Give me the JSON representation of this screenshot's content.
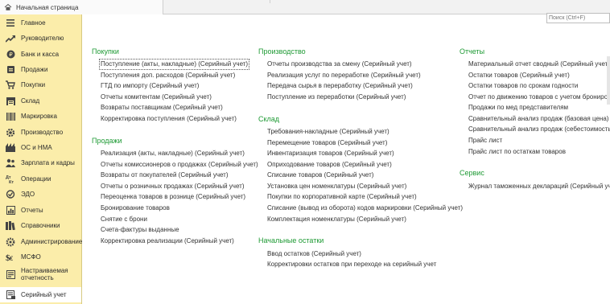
{
  "tabbar": {
    "home_label": "Начальная страница"
  },
  "search": {
    "placeholder": "Поиск (Ctrl+F)"
  },
  "sidebar": {
    "items": [
      {
        "label": "Главное",
        "icon": "menu-icon"
      },
      {
        "label": "Руководителю",
        "icon": "trend-icon"
      },
      {
        "label": "Банк и касса",
        "icon": "coin-icon"
      },
      {
        "label": "Продажи",
        "icon": "cart-icon"
      },
      {
        "label": "Покупки",
        "icon": "basket-icon"
      },
      {
        "label": "Склад",
        "icon": "warehouse-icon"
      },
      {
        "label": "Маркировка",
        "icon": "barcode-icon"
      },
      {
        "label": "Производство",
        "icon": "gear-icon"
      },
      {
        "label": "ОС и НМА",
        "icon": "building-icon"
      },
      {
        "label": "Зарплата и кадры",
        "icon": "people-icon"
      },
      {
        "label": "Операции",
        "icon": "dt-kt-icon"
      },
      {
        "label": "ЭДО",
        "icon": "edo-icon"
      },
      {
        "label": "Отчеты",
        "icon": "report-icon"
      },
      {
        "label": "Справочники",
        "icon": "books-icon"
      },
      {
        "label": "Администрирование",
        "icon": "settings-icon"
      },
      {
        "label": "МСФО",
        "icon": "msfo-icon"
      },
      {
        "label": "Настраиваемая отчетность",
        "icon": "custom-report-icon"
      },
      {
        "label": "Серийный учет",
        "icon": "serial-icon"
      }
    ],
    "selected_index": 17
  },
  "sections": {
    "purchases": {
      "title": "Покупки",
      "links": [
        "Поступление (акты, накладные) (Серийный учет)",
        "Поступления доп. расходов (Серийный учет)",
        "ГТД по импорту (Серийный учет)",
        "Отчеты комитентам (Серийный учет)",
        "Возвраты поставщикам (Серийный учет)",
        "Корректировка поступления (Серийный учет)"
      ]
    },
    "sales": {
      "title": "Продажи",
      "links": [
        "Реализация (акты, накладные) (Серийный учет)",
        "Отчеты комиссионеров о продажах (Серийный учет)",
        "Возвраты от покупателей (Серийный учет)",
        "Отчеты о розничных продажах (Серийный учет)",
        "Переоценка товаров в рознице (Серийный учет)",
        "Бронирование товаров",
        "Снятие с брони",
        "Счета-фактуры выданные",
        "Корректировка реализации (Серийный учет)"
      ]
    },
    "production": {
      "title": "Производство",
      "links": [
        "Отчеты производства за смену (Серийный учет)",
        "Реализация услуг по переработке (Серийный учет)",
        "Передача сырья в переработку (Серийный учет)",
        "Поступление из переработки (Серийный учет)"
      ]
    },
    "warehouse": {
      "title": "Склад",
      "links": [
        "Требования-накладные (Серийный учет)",
        "Перемещение товаров (Серийный учет)",
        "Инвентаризация товаров (Серийный учет)",
        "Оприходование товаров (Серийный учет)",
        "Списание товаров (Серийный учет)",
        "Установка цен номенклатуры (Серийный учет)",
        "Покупки по корпоративной карте (Серийный учет)",
        "Списание (вывод из оборота) кодов маркировки (Серийный учет)",
        "Комплектация номенклатуры (Серийный учет)"
      ]
    },
    "opening": {
      "title": "Начальные остатки",
      "links": [
        "Ввод остатков (Серийный учет)",
        "Корректировки остатков при переходе на серийный учет"
      ]
    },
    "reports": {
      "title": "Отчеты",
      "links": [
        "Материальный отчет сводный (Серийный учет)",
        "Остатки товаров (Серийный учет)",
        "Остатки товаров по срокам годности",
        "Отчет по движению товаров с учетом бронирования",
        "Продажи по мед представителям",
        "Сравнительный анализ продаж (базовая цена)",
        "Сравнительный анализ продаж (себестоимость)",
        "Прайс лист",
        "Прайс лист по остаткам товаров"
      ]
    },
    "service": {
      "title": "Сервис",
      "links": [
        "Журнал таможенных деклараций (Серийный учет)"
      ]
    }
  },
  "colors": {
    "sidebar_bg": "#fbedaa",
    "section_title": "#1e9a34",
    "link_text": "#333333"
  }
}
